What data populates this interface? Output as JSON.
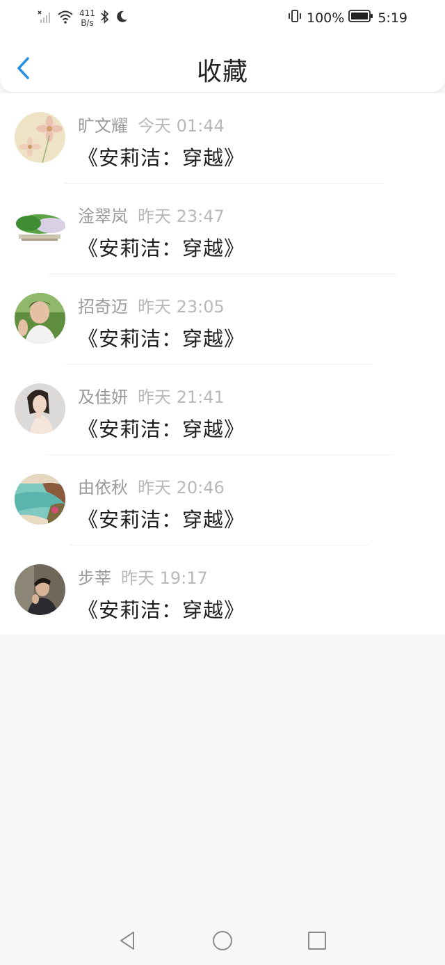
{
  "status_bar": {
    "net_speed_value": "411",
    "net_speed_unit": "B/s",
    "battery": "100%",
    "time": "5:19",
    "icons": [
      "signal-icon",
      "wifi-icon",
      "bluetooth-icon",
      "moon-icon",
      "vibrate-icon",
      "battery-icon"
    ]
  },
  "header": {
    "title": "收藏",
    "back_icon": "chevron-left-icon",
    "accent_color": "#2a8fe0"
  },
  "favorites": [
    {
      "name": "旷文耀",
      "time": "今天 01:44",
      "content": "《安莉洁：穿越》",
      "avatar": "flower-avatar"
    },
    {
      "name": "淦翠岚",
      "time": "昨天 23:47",
      "content": "《安莉洁：穿越》",
      "avatar": "cabbage-avatar"
    },
    {
      "name": "招奇迈",
      "time": "昨天 23:05",
      "content": "《安莉洁：穿越》",
      "avatar": "young-man-avatar"
    },
    {
      "name": "及佳妍",
      "time": "昨天 21:41",
      "content": "《安莉洁：穿越》",
      "avatar": "woman-avatar"
    },
    {
      "name": "由依秋",
      "time": "昨天 20:46",
      "content": "《安莉洁：穿越》",
      "avatar": "coast-avatar"
    },
    {
      "name": "步莘",
      "time": "昨天 19:17",
      "content": "《安莉洁：穿越》",
      "avatar": "portrait-avatar"
    }
  ],
  "bottom_nav": [
    "back-triangle-icon",
    "home-circle-icon",
    "recents-square-icon"
  ]
}
